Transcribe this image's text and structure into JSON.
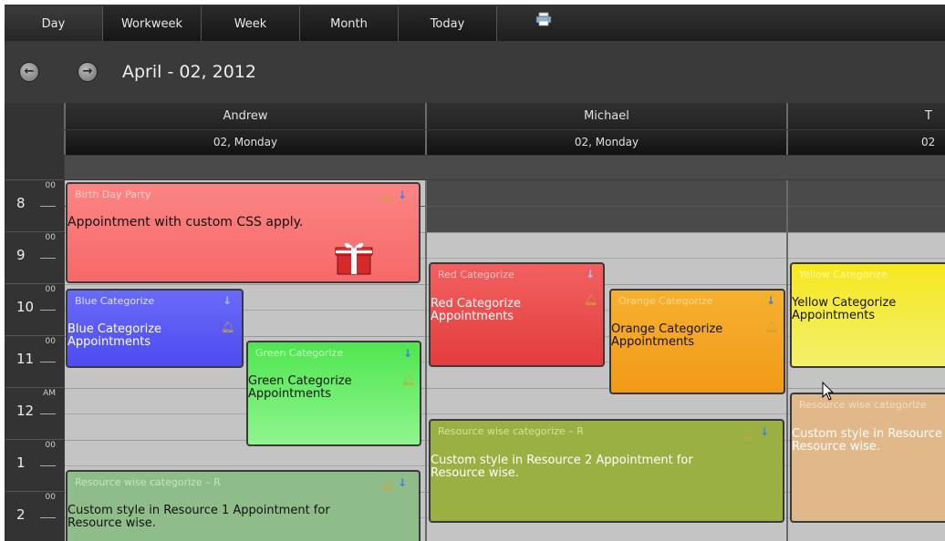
{
  "toolbar": {
    "views": [
      {
        "label": "Day",
        "active": true
      },
      {
        "label": "Workweek",
        "active": false
      },
      {
        "label": "Week",
        "active": false
      },
      {
        "label": "Month",
        "active": false
      },
      {
        "label": "Today",
        "active": false
      }
    ],
    "print_icon": "printer-icon"
  },
  "nav": {
    "prev_icon": "arrow-left-icon",
    "next_icon": "arrow-right-icon",
    "current_date": "April - 02, 2012"
  },
  "resources": [
    {
      "name": "Andrew",
      "day": "02, Monday"
    },
    {
      "name": "Michael",
      "day": "02, Monday"
    },
    {
      "name": "T",
      "day": "02"
    }
  ],
  "time_slots": [
    {
      "hour": "8",
      "minutes": "00"
    },
    {
      "hour": "9",
      "minutes": "00"
    },
    {
      "hour": "10",
      "minutes": "00"
    },
    {
      "hour": "11",
      "minutes": "00"
    },
    {
      "hour": "12",
      "minutes": "AM"
    },
    {
      "hour": "1",
      "minutes": "00"
    },
    {
      "hour": "2",
      "minutes": "00"
    }
  ],
  "appointments": [
    {
      "subject": "Birth Day Party",
      "body": "Appointment with custom CSS apply.",
      "color": "#fa7b7b"
    },
    {
      "subject": "Blue Categorize",
      "body": "Blue Categorize Appointments",
      "color": "#5b5bf5"
    },
    {
      "subject": "Green Categorize",
      "body": "Green Categorize Appointments",
      "color": "#6bf26b"
    },
    {
      "subject": "Resource wise categorize – R",
      "body": "Custom style in Resource 1 Appointment for Resource wise.",
      "color": "#8fbd89"
    },
    {
      "subject": "Red Categorize",
      "body": "Red Categorize Appointments",
      "color": "#ec4e4e"
    },
    {
      "subject": "Orange Categorize",
      "body": "Orange Categorize Appointments",
      "color": "#f5a623"
    },
    {
      "subject": "Resource wise categorize – R",
      "body": "Custom style in Resource 2 Appointment for Resource wise.",
      "color": "#9ab043"
    },
    {
      "subject": "Yellow Categorize",
      "body": "Yellow Categorize Appointments",
      "color": "#f4ea2e"
    },
    {
      "subject": "Resource wise categorize",
      "body": "Custom style in Resource Resource wise.",
      "color": "#e0b88a"
    }
  ]
}
